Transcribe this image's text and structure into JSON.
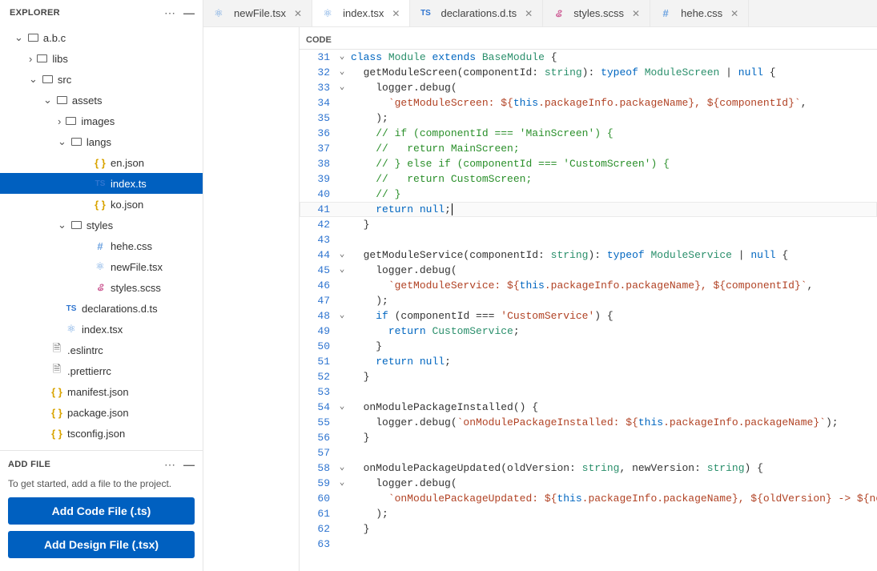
{
  "sidebar": {
    "title": "EXPLORER",
    "tree": [
      {
        "depth": 0,
        "twisty": "open",
        "icon": "folder",
        "label": "a.b.c"
      },
      {
        "depth": 1,
        "twisty": "closed",
        "icon": "folder",
        "label": "libs"
      },
      {
        "depth": 1,
        "twisty": "open",
        "icon": "folder",
        "label": "src"
      },
      {
        "depth": 2,
        "twisty": "open",
        "icon": "folder",
        "label": "assets"
      },
      {
        "depth": 3,
        "twisty": "closed",
        "icon": "folder",
        "label": "images"
      },
      {
        "depth": 3,
        "twisty": "open",
        "icon": "folder",
        "label": "langs"
      },
      {
        "depth": 4,
        "twisty": "none",
        "icon": "yellow",
        "iconText": "{ }",
        "label": "en.json"
      },
      {
        "depth": 4,
        "twisty": "none",
        "icon": "blue",
        "iconText": "TS",
        "label": "index.ts",
        "selected": true
      },
      {
        "depth": 4,
        "twisty": "none",
        "icon": "yellow",
        "iconText": "{ }",
        "label": "ko.json"
      },
      {
        "depth": 3,
        "twisty": "open",
        "icon": "folder",
        "label": "styles"
      },
      {
        "depth": 4,
        "twisty": "none",
        "icon": "hash",
        "iconText": "#",
        "label": "hehe.css"
      },
      {
        "depth": 4,
        "twisty": "none",
        "icon": "react",
        "iconText": "⚛",
        "label": "newFile.tsx"
      },
      {
        "depth": 4,
        "twisty": "none",
        "icon": "sass",
        "iconText": "ଌ",
        "label": "styles.scss"
      },
      {
        "depth": 2,
        "twisty": "none",
        "icon": "blue",
        "iconText": "TS",
        "label": "declarations.d.ts"
      },
      {
        "depth": 2,
        "twisty": "none",
        "icon": "react",
        "iconText": "⚛",
        "label": "index.tsx"
      },
      {
        "depth": 1,
        "twisty": "none",
        "icon": "grey",
        "iconText": "🗎",
        "label": ".eslintrc"
      },
      {
        "depth": 1,
        "twisty": "none",
        "icon": "grey",
        "iconText": "🗎",
        "label": ".prettierrc"
      },
      {
        "depth": 1,
        "twisty": "none",
        "icon": "yellow",
        "iconText": "{ }",
        "label": "manifest.json"
      },
      {
        "depth": 1,
        "twisty": "none",
        "icon": "yellow",
        "iconText": "{ }",
        "label": "package.json"
      },
      {
        "depth": 1,
        "twisty": "none",
        "icon": "yellow",
        "iconText": "{ }",
        "label": "tsconfig.json"
      }
    ]
  },
  "addfile": {
    "title": "ADD FILE",
    "hint": "To get started, add a file to the project.",
    "code_btn": "Add Code File (.ts)",
    "design_btn": "Add Design File (.tsx)"
  },
  "tabs": [
    {
      "icon": "react",
      "iconText": "⚛",
      "label": "newFile.tsx",
      "close": true
    },
    {
      "icon": "react",
      "iconText": "⚛",
      "label": "index.tsx",
      "close": true,
      "active": true
    },
    {
      "icon": "blue",
      "iconText": "TS",
      "label": "declarations.d.ts",
      "close": true
    },
    {
      "icon": "sass",
      "iconText": "ଌ",
      "label": "styles.scss",
      "close": true
    },
    {
      "icon": "hash",
      "iconText": "#",
      "label": "hehe.css",
      "close": true
    }
  ],
  "editor": {
    "header": "CODE",
    "lines": [
      {
        "n": 31,
        "fold": "open",
        "html": "<span class='kw'>class</span> <span class='cls'>Module</span> <span class='kw'>extends</span> <span class='cls'>BaseModule</span> {"
      },
      {
        "n": 32,
        "fold": "open",
        "indent": 1,
        "html": "<span class='prop'>getModuleScreen(componentId: </span><span class='cls'>string</span><span class='prop'>): </span><span class='kw'>typeof</span> <span class='cls'>ModuleScreen</span> <span class='pipe'>|</span> <span class='kw'>null</span> {"
      },
      {
        "n": 33,
        "fold": "open",
        "indent": 2,
        "html": "logger.debug("
      },
      {
        "n": 34,
        "fold": "",
        "indent": 3,
        "html": "<span class='str'>`getModuleScreen: ${</span><span class='tvar'>this</span><span class='str'>.packageInfo.packageName}, ${componentId}`</span>,"
      },
      {
        "n": 35,
        "fold": "",
        "indent": 2,
        "html": ");"
      },
      {
        "n": 36,
        "fold": "",
        "indent": 2,
        "html": "<span class='cmt'>// if (componentId === 'MainScreen') {</span>"
      },
      {
        "n": 37,
        "fold": "",
        "indent": 2,
        "html": "<span class='cmt'>//   return MainScreen;</span>"
      },
      {
        "n": 38,
        "fold": "",
        "indent": 2,
        "html": "<span class='cmt'>// } else if (componentId === 'CustomScreen') {</span>"
      },
      {
        "n": 39,
        "fold": "",
        "indent": 2,
        "html": "<span class='cmt'>//   return CustomScreen;</span>"
      },
      {
        "n": 40,
        "fold": "",
        "indent": 2,
        "html": "<span class='cmt'>// }</span>"
      },
      {
        "n": 41,
        "fold": "",
        "indent": 2,
        "current": true,
        "html": "<span class='kw'>return</span> <span class='kw'>null</span>;<span class='cursor'></span>"
      },
      {
        "n": 42,
        "fold": "",
        "indent": 1,
        "html": "}"
      },
      {
        "n": 43,
        "fold": "",
        "indent": 0,
        "html": ""
      },
      {
        "n": 44,
        "fold": "open",
        "indent": 1,
        "html": "<span class='prop'>getModuleService(componentId: </span><span class='cls'>string</span><span class='prop'>): </span><span class='kw'>typeof</span> <span class='cls'>ModuleService</span> <span class='pipe'>|</span> <span class='kw'>null</span> {"
      },
      {
        "n": 45,
        "fold": "open",
        "indent": 2,
        "html": "logger.debug("
      },
      {
        "n": 46,
        "fold": "",
        "indent": 3,
        "html": "<span class='str'>`getModuleService: ${</span><span class='tvar'>this</span><span class='str'>.packageInfo.packageName}, ${componentId}`</span>,"
      },
      {
        "n": 47,
        "fold": "",
        "indent": 2,
        "html": ");"
      },
      {
        "n": 48,
        "fold": "open",
        "indent": 2,
        "html": "<span class='kw'>if</span> (componentId === <span class='str'>'CustomService'</span>) {"
      },
      {
        "n": 49,
        "fold": "",
        "indent": 3,
        "html": "<span class='kw'>return</span> <span class='cls'>CustomService</span>;"
      },
      {
        "n": 50,
        "fold": "",
        "indent": 2,
        "html": "}"
      },
      {
        "n": 51,
        "fold": "",
        "indent": 2,
        "html": "<span class='kw'>return</span> <span class='kw'>null</span>;"
      },
      {
        "n": 52,
        "fold": "",
        "indent": 1,
        "html": "}"
      },
      {
        "n": 53,
        "fold": "",
        "indent": 0,
        "html": ""
      },
      {
        "n": 54,
        "fold": "open",
        "indent": 1,
        "html": "onModulePackageInstalled() {"
      },
      {
        "n": 55,
        "fold": "",
        "indent": 2,
        "html": "logger.debug(<span class='str'>`onModulePackageInstalled: ${</span><span class='tvar'>this</span><span class='str'>.packageInfo.packageName}`</span>);"
      },
      {
        "n": 56,
        "fold": "",
        "indent": 1,
        "html": "}"
      },
      {
        "n": 57,
        "fold": "",
        "indent": 0,
        "html": ""
      },
      {
        "n": 58,
        "fold": "open",
        "indent": 1,
        "html": "onModulePackageUpdated(oldVersion: <span class='cls'>string</span>, newVersion: <span class='cls'>string</span>) {"
      },
      {
        "n": 59,
        "fold": "open",
        "indent": 2,
        "html": "logger.debug("
      },
      {
        "n": 60,
        "fold": "",
        "indent": 3,
        "html": "<span class='str'>`onModulePackageUpdated: ${</span><span class='tvar'>this</span><span class='str'>.packageInfo.packageName}, ${oldVersion} -> ${newVersion}`</span>,"
      },
      {
        "n": 61,
        "fold": "",
        "indent": 2,
        "html": ");"
      },
      {
        "n": 62,
        "fold": "",
        "indent": 1,
        "html": "}"
      },
      {
        "n": 63,
        "fold": "",
        "indent": 0,
        "html": ""
      }
    ]
  }
}
